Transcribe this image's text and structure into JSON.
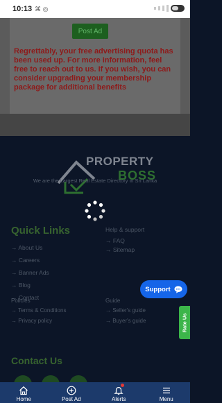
{
  "status_bar": {
    "time": "10:13",
    "left_icons": "⌘ ◎"
  },
  "message": {
    "button_label": "Post Ad",
    "text": "Regrettably, your free advertising quota has been used up. For more information, feel free to reach out to us. If you wish, you can consider upgrading your membership package for additional benefits"
  },
  "footer": {
    "logo_word1": "PROPERTY",
    "logo_word2": "BOSS",
    "tagline": "We are the Largest Real Estate Directory in Sri Lanka",
    "quick_links": {
      "heading": "Quick Links",
      "items": [
        "→ About Us",
        "→ Careers",
        "→ Banner Ads",
        "→ Blog",
        "→ Contact"
      ]
    },
    "help": {
      "heading": "Help & support",
      "items": [
        "→ FAQ",
        "→ Sitemap"
      ]
    },
    "policies": {
      "heading": "Policies",
      "items": [
        "→ Terms & Conditions",
        "→ Privacy policy"
      ]
    },
    "guide": {
      "heading": "Guide",
      "items": [
        "→ Seller's guide",
        "→ Buyer's guide"
      ]
    },
    "contact": {
      "heading": "Contact Us"
    }
  },
  "support_button": {
    "label": "Support"
  },
  "rate_tab": {
    "label": "Rate Us"
  },
  "bottom_nav": {
    "items": [
      {
        "label": "Home",
        "icon": "home-icon"
      },
      {
        "label": "Post Ad",
        "icon": "plus-circle-icon"
      },
      {
        "label": "Alerts",
        "icon": "bell-icon"
      },
      {
        "label": "Menu",
        "icon": "menu-icon"
      }
    ]
  },
  "colors": {
    "footer_bg": "#0c1527",
    "nav_bg": "#1c3a6b",
    "support_blue": "#1565e8",
    "rate_green": "#3cb54a",
    "message_red": "#8e1a1a"
  }
}
